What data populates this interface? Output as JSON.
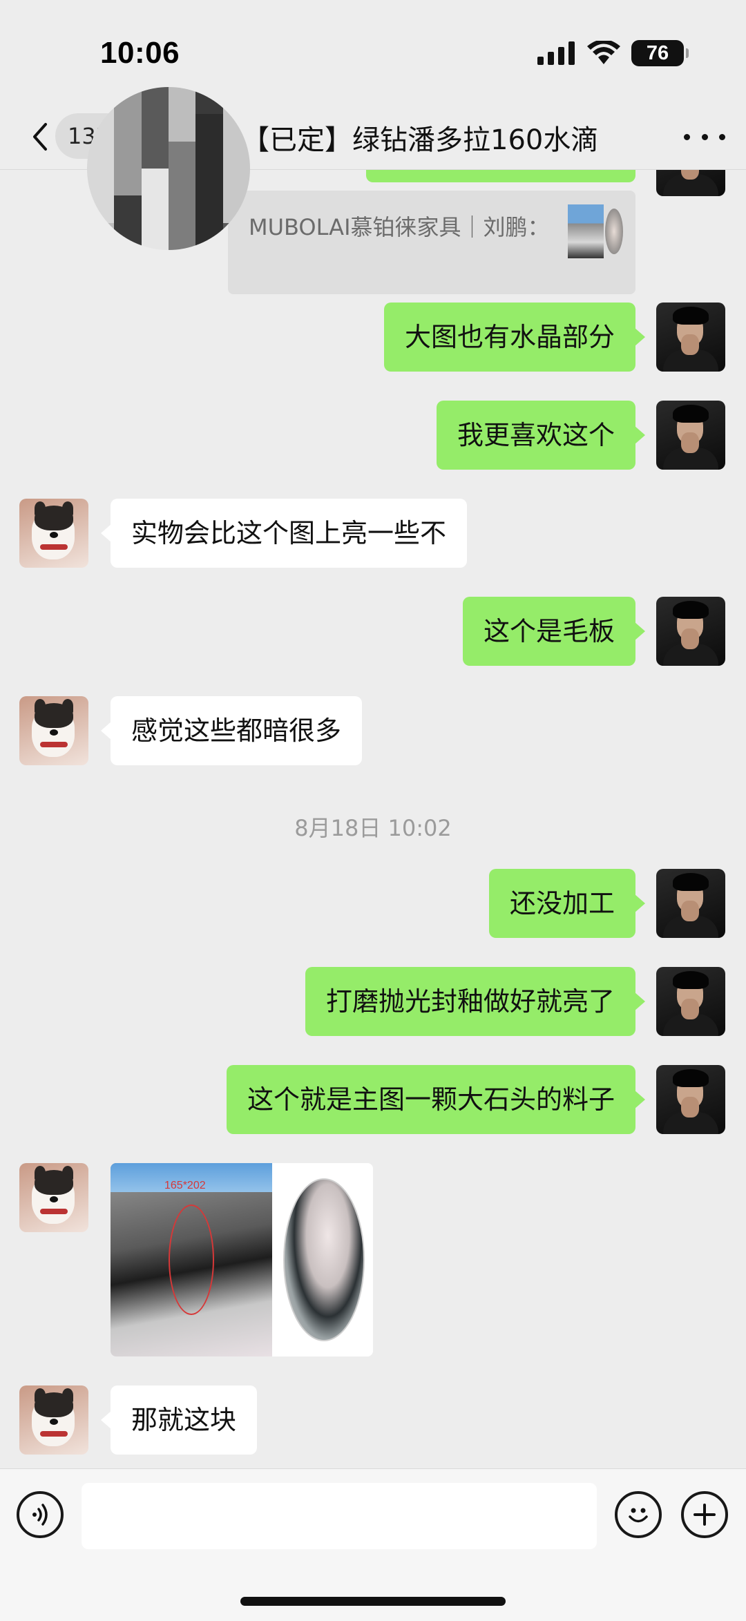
{
  "status_bar": {
    "time": "10:06",
    "battery": "76",
    "signal_icon": "signal-bars-icon",
    "wifi_icon": "wifi-icon"
  },
  "header": {
    "back_icon": "chevron-left-icon",
    "unread_badge": "132",
    "title": "【已定】绿钻潘多拉160水滴",
    "more_icon": "more-dots-icon"
  },
  "messages": [
    {
      "side": "me",
      "type": "quote",
      "text": "MUBOLAI慕铂徕家具｜刘鹏："
    },
    {
      "side": "me",
      "type": "text",
      "text": "大图也有水晶部分"
    },
    {
      "side": "me",
      "type": "text",
      "text": "我更喜欢这个"
    },
    {
      "side": "other",
      "type": "text",
      "text": "实物会比这个图上亮一些不"
    },
    {
      "side": "me",
      "type": "text",
      "text": "这个是毛板"
    },
    {
      "side": "other",
      "type": "text",
      "text": "感觉这些都暗很多"
    },
    {
      "type": "timestamp",
      "text": "8月18日 10:02"
    },
    {
      "side": "me",
      "type": "text",
      "text": "还没加工"
    },
    {
      "side": "me",
      "type": "text",
      "text": "打磨抛光封釉做好就亮了"
    },
    {
      "side": "me",
      "type": "text",
      "text": "这个就是主图一颗大石头的料子"
    },
    {
      "side": "other",
      "type": "image",
      "label": "165*202"
    },
    {
      "side": "other",
      "type": "text",
      "text": "那就这块"
    }
  ],
  "input_bar": {
    "voice_icon": "voice-icon",
    "emoji_icon": "emoji-icon",
    "plus_icon": "plus-icon",
    "value": ""
  },
  "colors": {
    "background": "#ededed",
    "my_bubble": "#95ec69",
    "other_bubble": "#ffffff",
    "timestamp": "#9b9b9b"
  }
}
